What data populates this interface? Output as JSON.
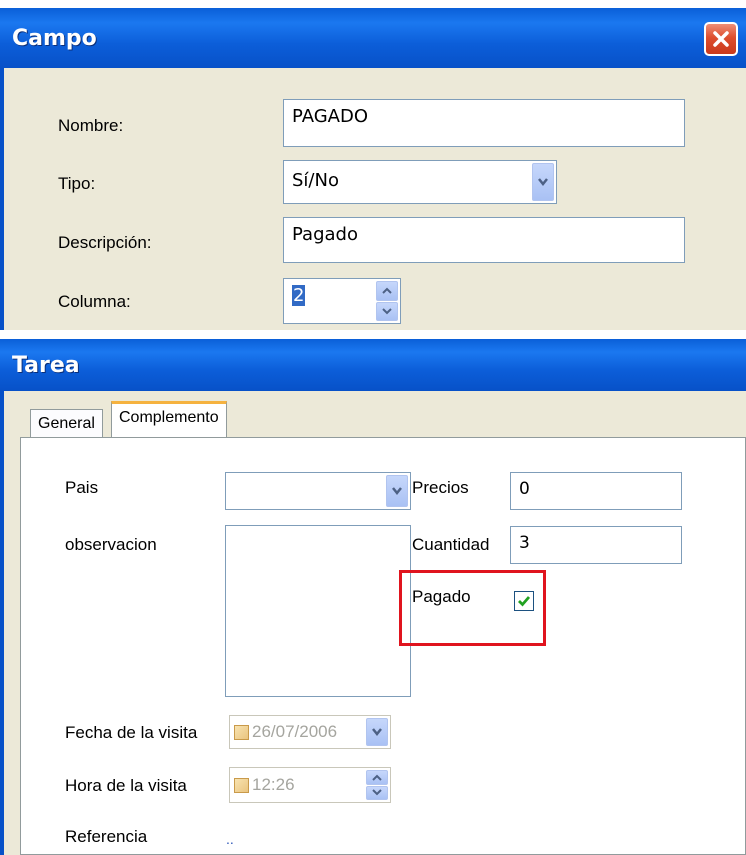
{
  "campo_dialog": {
    "title": "Campo",
    "fields": {
      "nombre_label": "Nombre:",
      "nombre_value": "PAGADO",
      "tipo_label": "Tipo:",
      "tipo_value": "Sí/No",
      "descripcion_label": "Descripción:",
      "descripcion_value": "Pagado",
      "columna_label": "Columna:",
      "columna_value": "2"
    }
  },
  "tarea_dialog": {
    "title": "Tarea",
    "tabs": [
      {
        "label": "General",
        "active": false
      },
      {
        "label": "Complemento",
        "active": true
      }
    ],
    "fields": {
      "pais_label": "Pais",
      "pais_value": "",
      "observacion_label": "observacion",
      "observacion_value": "",
      "precios_label": "Precios",
      "precios_value": "0",
      "cantidad_label": "Cuantidad",
      "cantidad_value": "3",
      "pagado_label": "Pagado",
      "pagado_checked": true,
      "fecha_label": "Fecha de la visita",
      "fecha_value": "26/07/2006",
      "hora_label": "Hora de la visita",
      "hora_value": "12:26",
      "referencia_label": "Referencia",
      "referencia_value": ".."
    }
  },
  "icons": {
    "close": "close-icon",
    "dropdown": "chevron-down-icon",
    "spin_up": "chevron-up-icon",
    "spin_down": "chevron-down-icon",
    "check": "check-icon"
  },
  "colors": {
    "titlebar_blue": "#0a5fd8",
    "dialog_bg": "#ece9d8",
    "highlight_red": "#e0141e",
    "check_green": "#21a121",
    "input_border": "#7f9db9"
  }
}
